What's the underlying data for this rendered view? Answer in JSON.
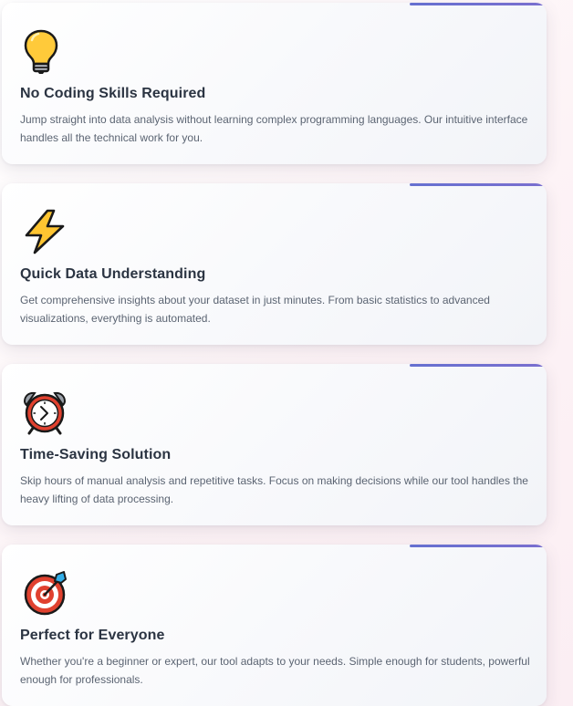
{
  "features": [
    {
      "icon": "lightbulb-icon",
      "title": "No Coding Skills Required",
      "description": "Jump straight into data analysis without learning complex programming languages. Our intuitive interface handles all the technical work for you."
    },
    {
      "icon": "lightning-bolt-icon",
      "title": "Quick Data Understanding",
      "description": "Get comprehensive insights about your dataset in just minutes. From basic statistics to advanced visualizations, everything is automated."
    },
    {
      "icon": "alarm-clock-icon",
      "title": "Time-Saving Solution",
      "description": "Skip hours of manual analysis and repetitive tasks. Focus on making decisions while our tool handles the heavy lifting of data processing."
    },
    {
      "icon": "target-icon",
      "title": "Perfect for Everyone",
      "description": "Whether you're a beginner or expert, our tool adapts to your needs. Simple enough for students, powerful enough for professionals."
    }
  ],
  "colors": {
    "accent": "#6670d0",
    "title": "#2b3442",
    "text": "#5b6472"
  }
}
